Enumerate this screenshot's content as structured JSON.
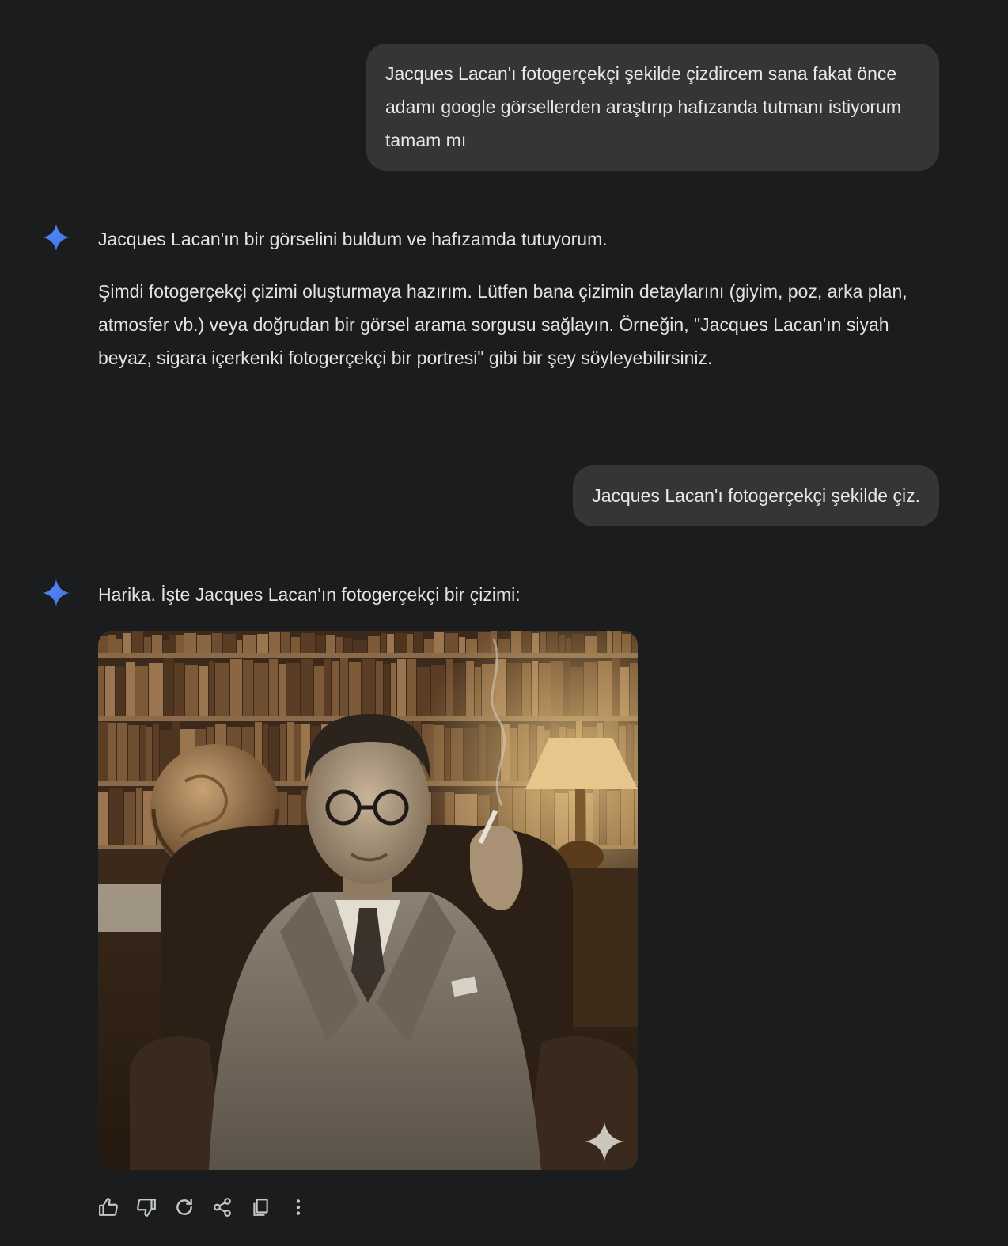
{
  "conversation": {
    "user_message_1": "Jacques Lacan'ı fotogerçekçi şekilde çizdircem sana fakat önce adamı google görsellerden araştırıp hafızanda tutmanı istiyorum tamam mı",
    "model_response_1": {
      "paragraph_1": "Jacques Lacan'ın bir görselini buldum ve hafızamda tutuyorum.",
      "paragraph_2": "Şimdi fotogerçekçi çizimi oluşturmaya hazırım. Lütfen bana çizimin detaylarını (giyim, poz, arka plan, atmosfer vb.) veya doğrudan bir görsel arama sorgusu sağlayın. Örneğin, \"Jacques Lacan'ın siyah beyaz, sigara içerkenki fotogerçekçi bir portresi\" gibi bir şey söyleyebilirsiniz."
    },
    "user_message_2": "Jacques Lacan'ı fotogerçekçi şekilde çiz.",
    "model_response_2": {
      "paragraph_1": "Harika. İşte Jacques Lacan'ın fotogerçekçi bir çizimi:",
      "image_description_icon": "sparkle-watermark-icon"
    }
  },
  "response_actions": [
    {
      "name": "thumbs-up-icon"
    },
    {
      "name": "thumbs-down-icon"
    },
    {
      "name": "regenerate-icon"
    },
    {
      "name": "share-icon"
    },
    {
      "name": "copy-icon"
    },
    {
      "name": "more-options-icon"
    }
  ],
  "colors": {
    "background": "#1b1c1e",
    "user_bubble": "#333537",
    "text": "#e3e3e3",
    "spark_blue": "#4285f4",
    "icon_gray": "#c4c7c5"
  }
}
